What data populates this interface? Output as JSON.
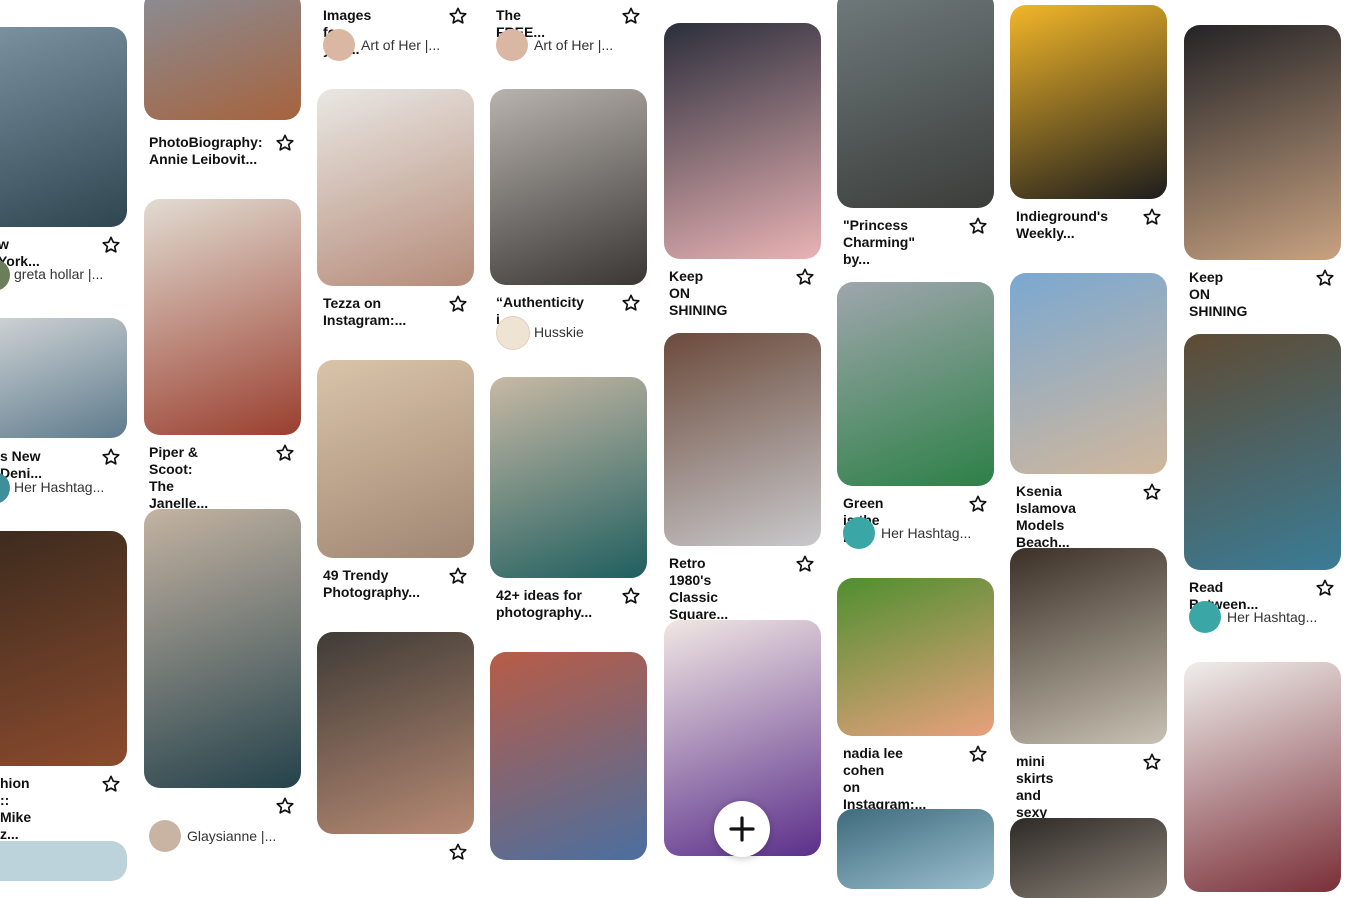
{
  "pins": [
    {
      "id": "c0-1",
      "title": "w York...",
      "author": "greta hollar |...",
      "colors": [
        "#7e93a3",
        "#2f4650"
      ]
    },
    {
      "id": "c0-2",
      "title": "s New Deni...",
      "author": "Her Hashtag...",
      "colors": [
        "#d3d6d8",
        "#5e7b8c"
      ]
    },
    {
      "id": "c0-3",
      "title": "hion :: Mike\nz...",
      "author": "",
      "colors": [
        "#3a2a1d",
        "#8b4b2e"
      ]
    },
    {
      "id": "c1-1",
      "title": "PhotoBiography:\nAnnie Leibovit...",
      "author": "",
      "colors": [
        "#8a8d96",
        "#a6633d"
      ]
    },
    {
      "id": "c1-2",
      "title": "Piper & Scoot:\nThe Janelle...",
      "author": "",
      "colors": [
        "#e2dcd2",
        "#9a3f2f"
      ]
    },
    {
      "id": "c1-3",
      "title": "",
      "author": "Glaysianne |...",
      "colors": [
        "#c4b3a2",
        "#24424b"
      ]
    },
    {
      "id": "c2-0",
      "title": "Images for you...",
      "author": "Art of Her |...",
      "colors": []
    },
    {
      "id": "c2-1",
      "title": "Tezza on\nInstagram:...",
      "author": "",
      "colors": [
        "#e9e7e3",
        "#b58b79"
      ]
    },
    {
      "id": "c2-2",
      "title": "49 Trendy\nPhotography...",
      "author": "",
      "colors": [
        "#d9c4a9",
        "#a08673"
      ]
    },
    {
      "id": "c2-3",
      "title": "",
      "author": "",
      "colors": [
        "#3f3b36",
        "#b78a74"
      ]
    },
    {
      "id": "c3-0",
      "title": "The FREE...",
      "author": "Art of Her |...",
      "colors": []
    },
    {
      "id": "c3-1",
      "title": "“Authenticity i...",
      "author": "Husskie",
      "colors": [
        "#b8b3ae",
        "#3a3634"
      ]
    },
    {
      "id": "c3-2",
      "title": "42+ ideas for\nphotography...",
      "author": "",
      "colors": [
        "#c8b9a5",
        "#1f5f5f"
      ]
    },
    {
      "id": "c3-3",
      "title": "",
      "author": "",
      "colors": [
        "#b85c46",
        "#4a6fa0"
      ]
    },
    {
      "id": "c4-1",
      "title": "Keep ON\nSHINING",
      "author": "",
      "colors": [
        "#2b2e3b",
        "#e9b3b5"
      ]
    },
    {
      "id": "c4-2",
      "title": "Retro 1980's\nClassic Square...",
      "author": "",
      "colors": [
        "#6b4a3b",
        "#c9c9cc"
      ]
    },
    {
      "id": "c4-3",
      "title": "",
      "author": "",
      "colors": [
        "#f1e7e3",
        "#5b2f8b"
      ]
    },
    {
      "id": "c5-1",
      "title": "\"Princess\nCharming\" by...",
      "author": "",
      "colors": [
        "#6f7a7c",
        "#3b3d3a"
      ]
    },
    {
      "id": "c5-2",
      "title": "Green is the n...",
      "author": "Her Hashtag...",
      "colors": [
        "#9fa6ad",
        "#2d8047"
      ]
    },
    {
      "id": "c5-3",
      "title": "nadia lee cohen\non Instagram:...",
      "author": "",
      "colors": [
        "#4f8f2f",
        "#e9a07d"
      ]
    },
    {
      "id": "c5-4",
      "title": "",
      "author": "",
      "colors": [
        "#3e6b7d",
        "#9bbfcf"
      ]
    },
    {
      "id": "c6-1",
      "title": "Indieground's\nWeekly...",
      "author": "",
      "colors": [
        "#f2b629",
        "#1d1d1d"
      ]
    },
    {
      "id": "c6-2",
      "title": "Ksenia Islamova\nModels Beach...",
      "author": "",
      "colors": [
        "#7aa8d1",
        "#d1b79c"
      ]
    },
    {
      "id": "c6-3",
      "title": "mini skirts and\nsexy legs: Photo",
      "author": "",
      "colors": [
        "#3b3026",
        "#c9c1b3"
      ]
    },
    {
      "id": "c6-4",
      "title": "",
      "author": "",
      "colors": [
        "#2e2a27",
        "#8a8277"
      ]
    },
    {
      "id": "c7-1",
      "title": "Keep ON\nSHINING",
      "author": "",
      "colors": [
        "#232326",
        "#c8a281"
      ]
    },
    {
      "id": "c7-2",
      "title": "Read Between...",
      "author": "Her Hashtag...",
      "colors": [
        "#5e4b34",
        "#3a7c96"
      ]
    },
    {
      "id": "c7-3",
      "title": "",
      "author": "",
      "colors": [
        "#f0eeec",
        "#7a2f38"
      ]
    }
  ],
  "fab": {
    "icon": "plus-icon"
  }
}
